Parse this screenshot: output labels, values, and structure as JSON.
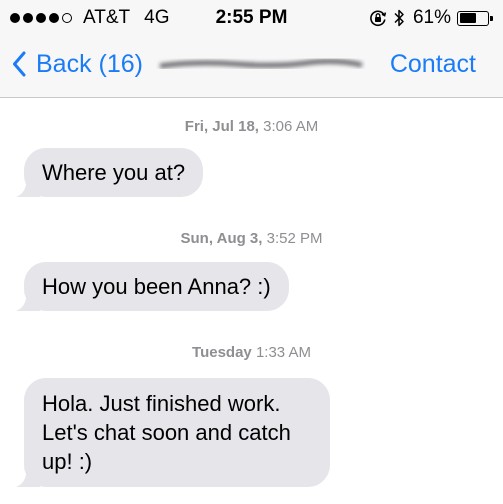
{
  "status_bar": {
    "carrier": "AT&T",
    "network": "4G",
    "time": "2:55 PM",
    "battery_percent": "61%",
    "battery_level": 0.61,
    "signal_bars_filled": 4,
    "signal_bars_total": 5,
    "icons": [
      "rotation-lock-icon",
      "bluetooth-icon",
      "battery-icon"
    ]
  },
  "nav": {
    "back_label": "Back (16)",
    "contact_label": "Contact",
    "accent_color": "#1a7cf6"
  },
  "messages": [
    {
      "date": "Fri, Jul 18,",
      "time": "3:06 AM",
      "text": "Where you at?"
    },
    {
      "date": "Sun, Aug 3,",
      "time": "3:52 PM",
      "text": "How you been Anna? :)"
    },
    {
      "date": "Tuesday",
      "time": "1:33 AM",
      "text": "Hola. Just finished work. Let's chat soon and catch up! :)"
    }
  ],
  "colors": {
    "bubble_background": "#e5e5ea",
    "timestamp_text": "#8e8e93",
    "bar_background": "#f7f7f7"
  }
}
